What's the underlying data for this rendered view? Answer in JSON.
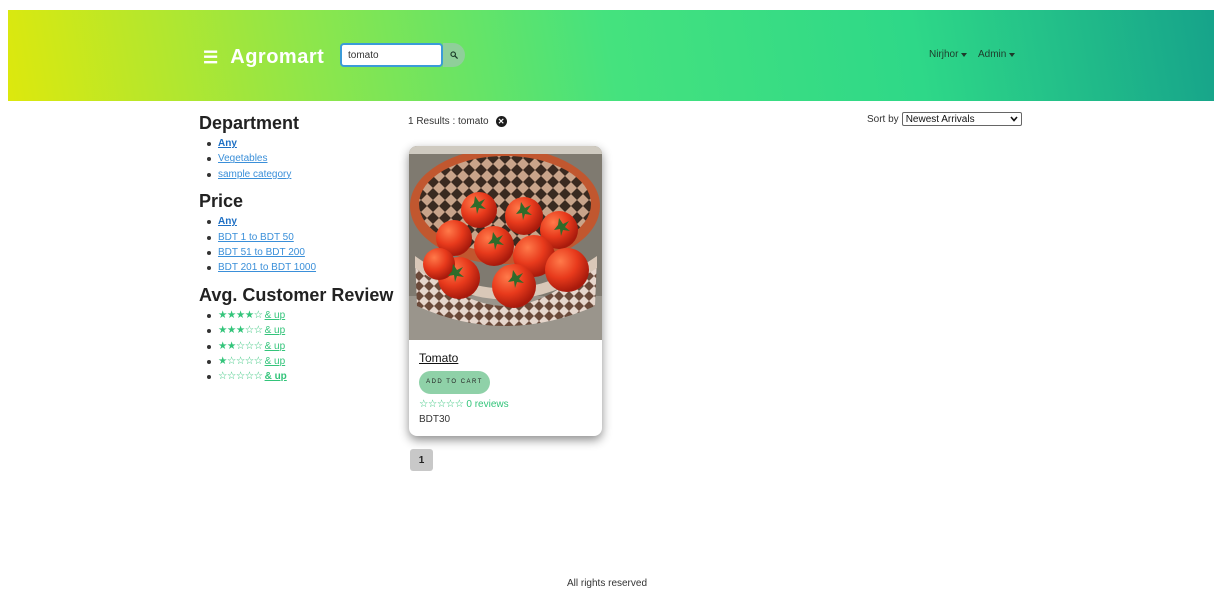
{
  "header": {
    "menu_icon": "☰",
    "brand": "Agromart",
    "search": {
      "value": "tomato"
    },
    "user_menu": "Nirjhor",
    "admin_menu": "Admin"
  },
  "sidebar": {
    "department": {
      "heading": "Department",
      "items": [
        "Any",
        "Vegetables",
        "sample category"
      ]
    },
    "price": {
      "heading": "Price",
      "items": [
        "Any",
        "BDT 1 to BDT 50",
        "BDT 51 to BDT 200",
        "BDT 201 to BDT 1000"
      ]
    },
    "reviews": {
      "heading": "Avg. Customer Review",
      "items": [
        {
          "stars": "★★★★☆",
          "rating": 4,
          "label": "& up"
        },
        {
          "stars": "★★★☆☆",
          "rating": 3,
          "label": "& up"
        },
        {
          "stars": "★★☆☆☆",
          "rating": 2,
          "label": "& up"
        },
        {
          "stars": "★☆☆☆☆",
          "rating": 1,
          "label": "& up"
        },
        {
          "stars": "☆☆☆☆☆",
          "rating": 0,
          "label": "& up"
        }
      ]
    }
  },
  "results": {
    "text": "1 Results : tomato",
    "clear_icon": "✕"
  },
  "sort": {
    "label": "Sort by",
    "selected": "Newest Arrivals"
  },
  "product": {
    "name": "Tomato",
    "add_to_cart": "ADD TO CART",
    "rating_stars": "☆☆☆☆☆",
    "rating": 0,
    "reviews": "0 reviews",
    "price": "BDT30"
  },
  "pagination": {
    "current": "1"
  },
  "footer": {
    "text": "All rights reserved"
  },
  "colors": {
    "accent_green": "#33c47a",
    "link_blue": "#3a8fd9",
    "cart_button": "#8fd1a8"
  }
}
